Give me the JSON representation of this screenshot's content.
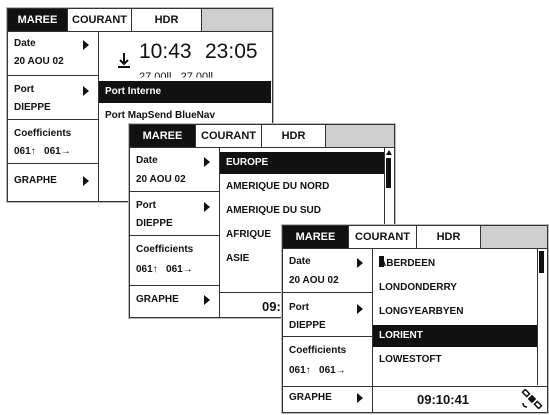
{
  "tabs": {
    "maree": "MAREE",
    "courant": "COURANT",
    "hdr": "HDR"
  },
  "sidebar": {
    "date_label": "Date",
    "date_value": "20 AOU 02",
    "port_label": "Port",
    "port_value": "DIEPPE",
    "coef_label": "Coefficients",
    "coef_value": "061↑   061→",
    "graphe_label": "GRAPHE"
  },
  "screen1": {
    "time1": "10:43",
    "time2": "23:05",
    "partial_values": "27.00ll   27.00ll",
    "dropdown": [
      "Port Interne",
      "Port MapSend BlueNav"
    ],
    "selected_index": 0
  },
  "screen2": {
    "regions": [
      "EUROPE",
      "AMERIQUE DU NORD",
      "AMERIQUE DU SUD",
      "AFRIQUE",
      "ASIE"
    ],
    "selected_index": 0,
    "footer_time_partial": "09:"
  },
  "screen3": {
    "ports": [
      "ABERDEEN",
      "LONDONDERRY",
      "LONGYEARBYEN",
      "LORIENT",
      "LOWESTOFT"
    ],
    "selected_index": 3,
    "footer_time": "09:10:41",
    "satellite_icon": "satellite-icon"
  }
}
